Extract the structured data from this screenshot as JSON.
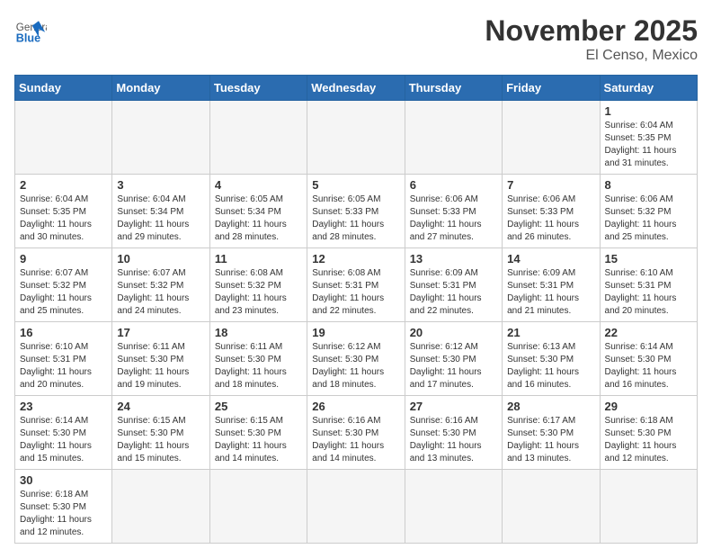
{
  "logo": {
    "general": "General",
    "blue": "Blue"
  },
  "title": "November 2025",
  "subtitle": "El Censo, Mexico",
  "weekdays": [
    "Sunday",
    "Monday",
    "Tuesday",
    "Wednesday",
    "Thursday",
    "Friday",
    "Saturday"
  ],
  "weeks": [
    [
      {
        "day": "",
        "info": ""
      },
      {
        "day": "",
        "info": ""
      },
      {
        "day": "",
        "info": ""
      },
      {
        "day": "",
        "info": ""
      },
      {
        "day": "",
        "info": ""
      },
      {
        "day": "",
        "info": ""
      },
      {
        "day": "1",
        "info": "Sunrise: 6:04 AM\nSunset: 5:35 PM\nDaylight: 11 hours\nand 31 minutes."
      }
    ],
    [
      {
        "day": "2",
        "info": "Sunrise: 6:04 AM\nSunset: 5:35 PM\nDaylight: 11 hours\nand 30 minutes."
      },
      {
        "day": "3",
        "info": "Sunrise: 6:04 AM\nSunset: 5:34 PM\nDaylight: 11 hours\nand 29 minutes."
      },
      {
        "day": "4",
        "info": "Sunrise: 6:05 AM\nSunset: 5:34 PM\nDaylight: 11 hours\nand 28 minutes."
      },
      {
        "day": "5",
        "info": "Sunrise: 6:05 AM\nSunset: 5:33 PM\nDaylight: 11 hours\nand 28 minutes."
      },
      {
        "day": "6",
        "info": "Sunrise: 6:06 AM\nSunset: 5:33 PM\nDaylight: 11 hours\nand 27 minutes."
      },
      {
        "day": "7",
        "info": "Sunrise: 6:06 AM\nSunset: 5:33 PM\nDaylight: 11 hours\nand 26 minutes."
      },
      {
        "day": "8",
        "info": "Sunrise: 6:06 AM\nSunset: 5:32 PM\nDaylight: 11 hours\nand 25 minutes."
      }
    ],
    [
      {
        "day": "9",
        "info": "Sunrise: 6:07 AM\nSunset: 5:32 PM\nDaylight: 11 hours\nand 25 minutes."
      },
      {
        "day": "10",
        "info": "Sunrise: 6:07 AM\nSunset: 5:32 PM\nDaylight: 11 hours\nand 24 minutes."
      },
      {
        "day": "11",
        "info": "Sunrise: 6:08 AM\nSunset: 5:32 PM\nDaylight: 11 hours\nand 23 minutes."
      },
      {
        "day": "12",
        "info": "Sunrise: 6:08 AM\nSunset: 5:31 PM\nDaylight: 11 hours\nand 22 minutes."
      },
      {
        "day": "13",
        "info": "Sunrise: 6:09 AM\nSunset: 5:31 PM\nDaylight: 11 hours\nand 22 minutes."
      },
      {
        "day": "14",
        "info": "Sunrise: 6:09 AM\nSunset: 5:31 PM\nDaylight: 11 hours\nand 21 minutes."
      },
      {
        "day": "15",
        "info": "Sunrise: 6:10 AM\nSunset: 5:31 PM\nDaylight: 11 hours\nand 20 minutes."
      }
    ],
    [
      {
        "day": "16",
        "info": "Sunrise: 6:10 AM\nSunset: 5:31 PM\nDaylight: 11 hours\nand 20 minutes."
      },
      {
        "day": "17",
        "info": "Sunrise: 6:11 AM\nSunset: 5:30 PM\nDaylight: 11 hours\nand 19 minutes."
      },
      {
        "day": "18",
        "info": "Sunrise: 6:11 AM\nSunset: 5:30 PM\nDaylight: 11 hours\nand 18 minutes."
      },
      {
        "day": "19",
        "info": "Sunrise: 6:12 AM\nSunset: 5:30 PM\nDaylight: 11 hours\nand 18 minutes."
      },
      {
        "day": "20",
        "info": "Sunrise: 6:12 AM\nSunset: 5:30 PM\nDaylight: 11 hours\nand 17 minutes."
      },
      {
        "day": "21",
        "info": "Sunrise: 6:13 AM\nSunset: 5:30 PM\nDaylight: 11 hours\nand 16 minutes."
      },
      {
        "day": "22",
        "info": "Sunrise: 6:14 AM\nSunset: 5:30 PM\nDaylight: 11 hours\nand 16 minutes."
      }
    ],
    [
      {
        "day": "23",
        "info": "Sunrise: 6:14 AM\nSunset: 5:30 PM\nDaylight: 11 hours\nand 15 minutes."
      },
      {
        "day": "24",
        "info": "Sunrise: 6:15 AM\nSunset: 5:30 PM\nDaylight: 11 hours\nand 15 minutes."
      },
      {
        "day": "25",
        "info": "Sunrise: 6:15 AM\nSunset: 5:30 PM\nDaylight: 11 hours\nand 14 minutes."
      },
      {
        "day": "26",
        "info": "Sunrise: 6:16 AM\nSunset: 5:30 PM\nDaylight: 11 hours\nand 14 minutes."
      },
      {
        "day": "27",
        "info": "Sunrise: 6:16 AM\nSunset: 5:30 PM\nDaylight: 11 hours\nand 13 minutes."
      },
      {
        "day": "28",
        "info": "Sunrise: 6:17 AM\nSunset: 5:30 PM\nDaylight: 11 hours\nand 13 minutes."
      },
      {
        "day": "29",
        "info": "Sunrise: 6:18 AM\nSunset: 5:30 PM\nDaylight: 11 hours\nand 12 minutes."
      }
    ],
    [
      {
        "day": "30",
        "info": "Sunrise: 6:18 AM\nSunset: 5:30 PM\nDaylight: 11 hours\nand 12 minutes."
      },
      {
        "day": "",
        "info": ""
      },
      {
        "day": "",
        "info": ""
      },
      {
        "day": "",
        "info": ""
      },
      {
        "day": "",
        "info": ""
      },
      {
        "day": "",
        "info": ""
      },
      {
        "day": "",
        "info": ""
      }
    ]
  ]
}
